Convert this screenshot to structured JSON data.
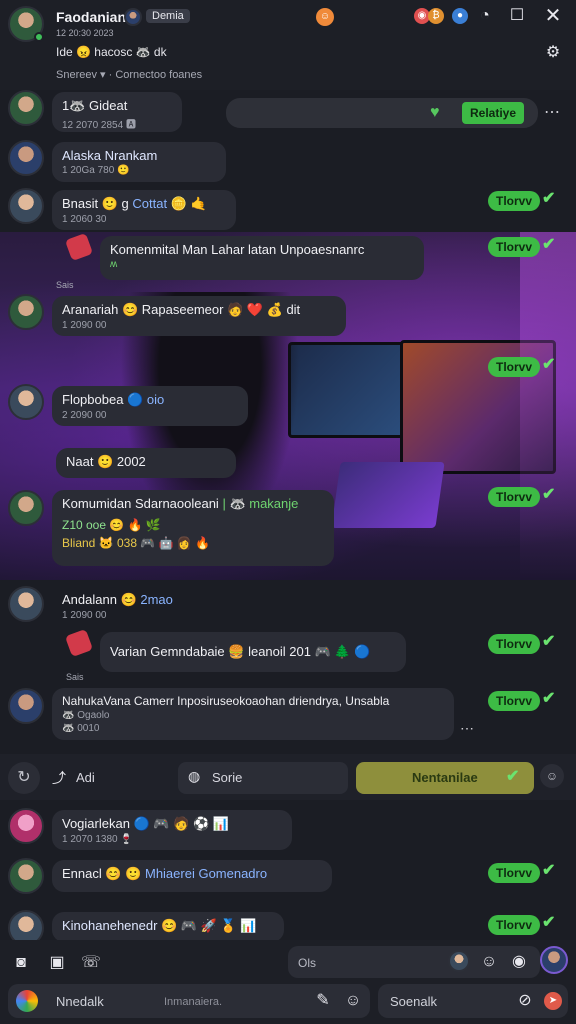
{
  "header": {
    "title": "Faodanian",
    "tag": "Demia",
    "line1": "Ide 😠 hacosc 🦝 dk",
    "line2": "Snereev ▾ · Cornectoo foanes",
    "timestamp": "12 20:30 2023"
  },
  "top_right": {
    "reply_label": "Relatiye"
  },
  "messages": [
    {
      "name": "1🦝 Gideat",
      "meta": "12 2070 2854 🅰"
    },
    {
      "name": "Alaska Nrankam",
      "meta": "1 20Ga 780 🙂"
    },
    {
      "name": "Bnasit 🙂 g",
      "highlight": "Cottat 🪙 🤙",
      "meta": "1 2060 30"
    },
    {
      "name": "Komenmital Man Lahar latan Unpoaesnanrc",
      "meta": "ʍ"
    },
    {
      "name": "Aranariah 😊 Rapaseemeor 🧑 ❤️ 💰 dit",
      "meta": "1 2090 00"
    },
    {
      "name": "Flopbobea",
      "highlight": "🔵 oio",
      "meta": "2 2090 00"
    },
    {
      "name": "Naat 🙂 2002",
      "highlight": "",
      "meta": ""
    },
    {
      "name": "Komumidan Sdarnaooleani",
      "green": "| 🦝 makanje",
      "meta": "Z10 ooe 😊 🔥 🌿",
      "meta2": "Bliand 🐱 038 🎮 🤖 👩 🔥"
    },
    {
      "name": "Andalann 😊",
      "highlight": "2mao",
      "meta": "1 2090 00"
    },
    {
      "name": "Varian Gemndabaie 🍔 leanoil 201 🎮 🌲 🔵",
      "meta": ""
    },
    {
      "name": "NahukaVana Camerr Inposiruseokoaohan driendrya, Unsabla",
      "meta": "🦝 Ogaolo",
      "meta2": "🦝 0010"
    },
    {
      "name": "Vogiarlekan 🔵 🎮 🧑 ⚽ 📊",
      "meta": "1 2070 1380 🍷"
    },
    {
      "name": "Ennacl 😊 🙂",
      "highlight": "Mhiaerei Gomenadro",
      "meta": ""
    },
    {
      "name": "Kinohanehenedr 😊 🎮 🚀 🏅 📊",
      "meta": ""
    }
  ],
  "status_pills": [
    "Tlorvv",
    "Tlorvv",
    "Tlorvv",
    "Tlorvv",
    "Tlorvv",
    "Tlorvv",
    "Tlorvv",
    "Tlorvv"
  ],
  "action_row": {
    "share_label": "Adi",
    "save_label": "Sorie",
    "mention_label": "Nentanilae"
  },
  "scene_caption": "Sais",
  "scene_caption2": "Sais",
  "composer": {
    "status": "Ols",
    "message_placeholder": "Nnedalk",
    "message_hint": "Inmanaiera.",
    "search_placeholder": "Soenalk"
  },
  "colors": {
    "accent_green": "#3dbb45",
    "bubble": "#2a2c35",
    "background": "#1b1d24",
    "scene_purple": "#7a3cd0"
  }
}
